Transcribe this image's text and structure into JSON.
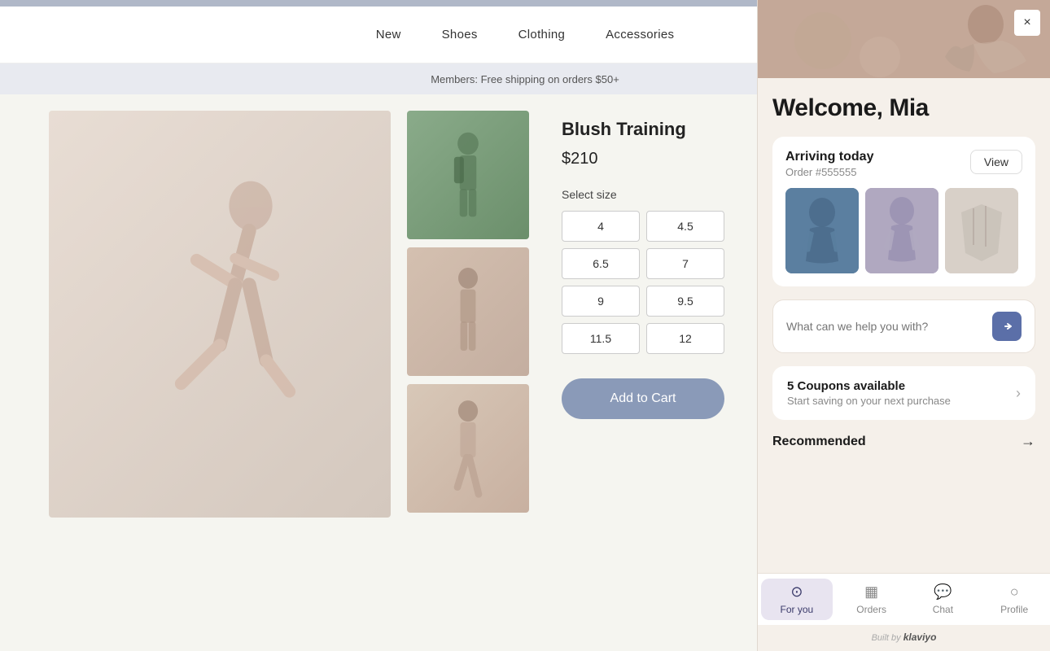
{
  "nav": {
    "items": [
      "New",
      "Shoes",
      "Clothing",
      "Accessories"
    ]
  },
  "banner": {
    "text": "Members: Free shipping on orders $50+"
  },
  "product": {
    "title": "Blush Training",
    "price": "$210",
    "size_label": "Select size",
    "sizes": [
      "4",
      "4.5",
      "6.5",
      "7",
      "9",
      "9.5",
      "11.5",
      "12"
    ],
    "add_to_cart": "Add to Cart"
  },
  "flyout": {
    "welcome": "Welcome, Mia",
    "close_label": "×",
    "arriving": {
      "title": "Arriving today",
      "order": "Order #555555",
      "view_btn": "View"
    },
    "chat_placeholder": "What can we help you with?",
    "coupons": {
      "count": "5 Coupons available",
      "subtitle": "Start saving on your next purchase"
    },
    "recommended": {
      "title": "Recommended"
    },
    "bottom_nav": [
      {
        "label": "For you",
        "icon": "⊙",
        "active": true
      },
      {
        "label": "Orders",
        "icon": "📦",
        "active": false
      },
      {
        "label": "Chat",
        "icon": "💬",
        "active": false
      },
      {
        "label": "Profile",
        "icon": "👤",
        "active": false
      }
    ],
    "built_by": "Built by",
    "built_by_brand": "klaviyo"
  }
}
